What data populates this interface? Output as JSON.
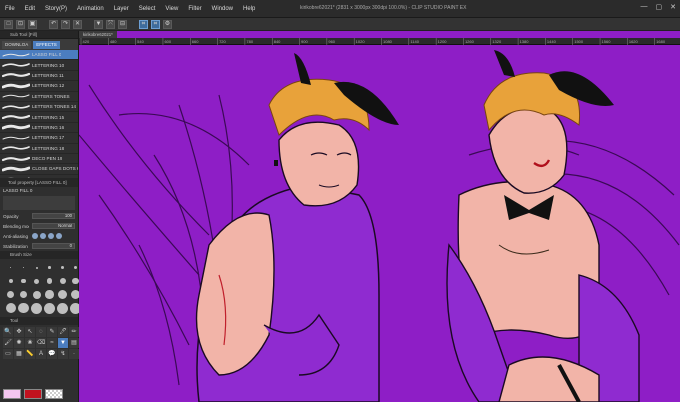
{
  "app": {
    "document_title": "kirikobre62021* (2831 x 3000px 300dpi 100.0%) - CLIP STUDIO PAINT EX",
    "window_buttons": [
      "—",
      "▢",
      "✕"
    ]
  },
  "menu": [
    "File",
    "Edit",
    "Story(P)",
    "Animation",
    "Layer",
    "Select",
    "View",
    "Filter",
    "Window",
    "Help"
  ],
  "command_bar": {
    "icons": [
      "new-icon",
      "open-icon",
      "save-icon",
      "undo-icon",
      "redo-icon",
      "clear-icon",
      "fill-icon",
      "transform-icon",
      "deselect-icon",
      "snap-icon",
      "snap-icon-2",
      "settings-icon"
    ]
  },
  "sub_tool": {
    "panel_title": "Sub Tool [Fill]",
    "tabs": [
      "DOWNLOA",
      "EFFECTS"
    ],
    "items": [
      {
        "name": "LASSO FILL 0",
        "selected": true
      },
      {
        "name": "LETTERING 10",
        "selected": false
      },
      {
        "name": "LETTERING 11",
        "selected": false
      },
      {
        "name": "LETTERING 12",
        "selected": false
      },
      {
        "name": "LETTERS TONES",
        "selected": false
      },
      {
        "name": "LETTERS TONES 14",
        "selected": false
      },
      {
        "name": "LETTERING 15",
        "selected": false
      },
      {
        "name": "LETTERING 16",
        "selected": false
      },
      {
        "name": "LETTERING 17",
        "selected": false
      },
      {
        "name": "LETTERING 18",
        "selected": false
      },
      {
        "name": "DECO PEN 19",
        "selected": false
      },
      {
        "name": "CLOSE GAPS DOTS 60",
        "selected": false
      },
      {
        "name": "SINGLE COLOUR DOTS 61",
        "selected": false
      }
    ]
  },
  "tool_property": {
    "panel_title": "Tool property [LASSO FILL 0]",
    "tool_name": "LASSO FILL 0",
    "rows": [
      {
        "label": "Opacity",
        "value": "100"
      },
      {
        "label": "Blending mode",
        "value": "Normal"
      },
      {
        "label": "Anti-aliasing",
        "value": ""
      },
      {
        "label": "Stabilization",
        "value": "0"
      }
    ]
  },
  "brush_size": {
    "panel_title": "Brush Size"
  },
  "tools": {
    "panel_title": "Tool",
    "icons": [
      "zoom-icon",
      "move-icon",
      "operation-icon",
      "lasso-icon",
      "eyedropper-icon",
      "pen-icon",
      "pencil-icon",
      "brush-icon",
      "airbrush-icon",
      "decoration-icon",
      "eraser-icon",
      "blend-icon",
      "fill-icon",
      "gradient-icon",
      "figure-icon",
      "frame-icon",
      "ruler-icon",
      "text-icon",
      "balloon-icon",
      "line-fix-icon",
      "blank-icon"
    ],
    "glyphs": [
      "🔍",
      "✥",
      "↖",
      "◌",
      "✎",
      "🖊",
      "✏",
      "🖌",
      "✺",
      "❀",
      "⌫",
      "≈",
      "▼",
      "▤",
      "▭",
      "▦",
      "📏",
      "A",
      "💬",
      "↯",
      "·"
    ],
    "active_index": 12
  },
  "colors": {
    "main": "#f4c6f0",
    "sub": "#c1121f",
    "canvas_bg": "#8e1ec6",
    "accent": "#4b7dbf"
  },
  "canvas": {
    "tab_label": "kirikobre62021*",
    "ruler_labels": [
      "420",
      "480",
      "540",
      "600",
      "660",
      "720",
      "780",
      "840",
      "900",
      "960",
      "1020",
      "1080",
      "1140",
      "1200",
      "1260",
      "1320",
      "1380",
      "1440",
      "1500",
      "1560",
      "1620",
      "1680"
    ]
  }
}
